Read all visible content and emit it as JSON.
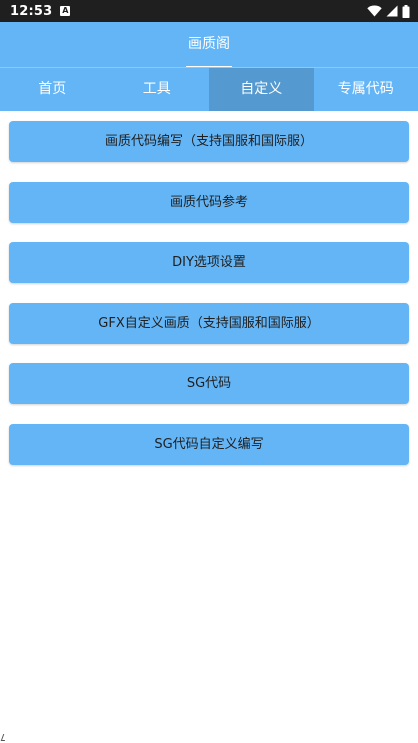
{
  "status_bar": {
    "time": "12:53",
    "notification_glyph": "A",
    "icons": [
      "wifi-icon",
      "signal-icon",
      "battery-icon"
    ]
  },
  "header": {
    "title": "画质阁"
  },
  "tabs": [
    {
      "label": "首页",
      "active": false
    },
    {
      "label": "工具",
      "active": false
    },
    {
      "label": "自定义",
      "active": true
    },
    {
      "label": "专属代码",
      "active": false
    }
  ],
  "buttons": [
    {
      "label": "画质代码编写（支持国服和国际服）"
    },
    {
      "label": "画质代码参考"
    },
    {
      "label": "DIY选项设置"
    },
    {
      "label": "GFX自定义画质（支持国服和国际服）"
    },
    {
      "label": "SG代码"
    },
    {
      "label": "SG代码自定义编写"
    }
  ],
  "colors": {
    "primary": "#64b5f6",
    "tab_active": "#5499cf",
    "status_bar": "#1f1f1f",
    "background": "#ffffff"
  }
}
